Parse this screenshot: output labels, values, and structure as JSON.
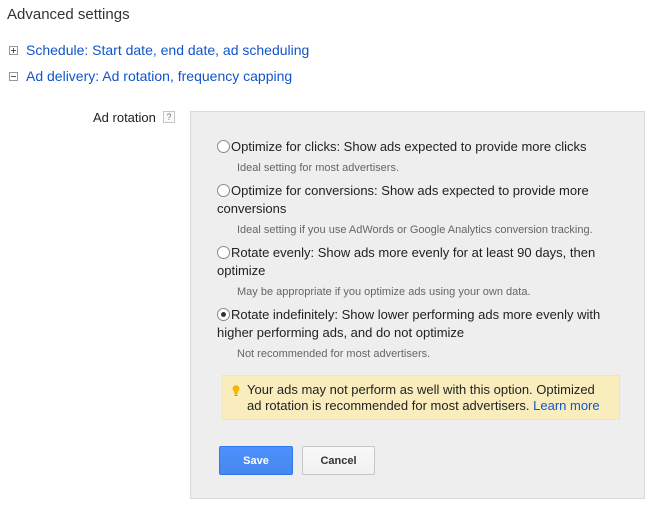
{
  "header": {
    "title": "Advanced settings"
  },
  "sections": [
    {
      "label": "Schedule: Start date, end date, ad scheduling",
      "expanded": false
    },
    {
      "label": "Ad delivery: Ad rotation, frequency capping",
      "expanded": true
    }
  ],
  "ad_rotation": {
    "label": "Ad rotation",
    "help": "?",
    "selected_index": 3,
    "options": [
      {
        "label": "Optimize for clicks: Show ads expected to provide more clicks",
        "description": "Ideal setting for most advertisers."
      },
      {
        "label": "Optimize for conversions: Show ads expected to provide more conversions",
        "description": "Ideal setting if you use AdWords or Google Analytics conversion tracking."
      },
      {
        "label": "Rotate evenly: Show ads more evenly for at least 90 days, then optimize",
        "description": "May be appropriate if you optimize ads using your own data."
      },
      {
        "label": "Rotate indefinitely: Show lower performing ads more evenly with higher performing ads, and do not optimize",
        "description": "Not recommended for most advertisers."
      }
    ],
    "notice": {
      "text": "Your ads may not perform as well with this option. Optimized ad rotation is recommended for most advertisers.",
      "link": "Learn more"
    },
    "save_label": "Save",
    "cancel_label": "Cancel"
  },
  "colors": {
    "link": "#1155cc",
    "primary_button": "#4d90fe",
    "notice_background": "#f9edbe",
    "bulb": "#f4b400"
  }
}
